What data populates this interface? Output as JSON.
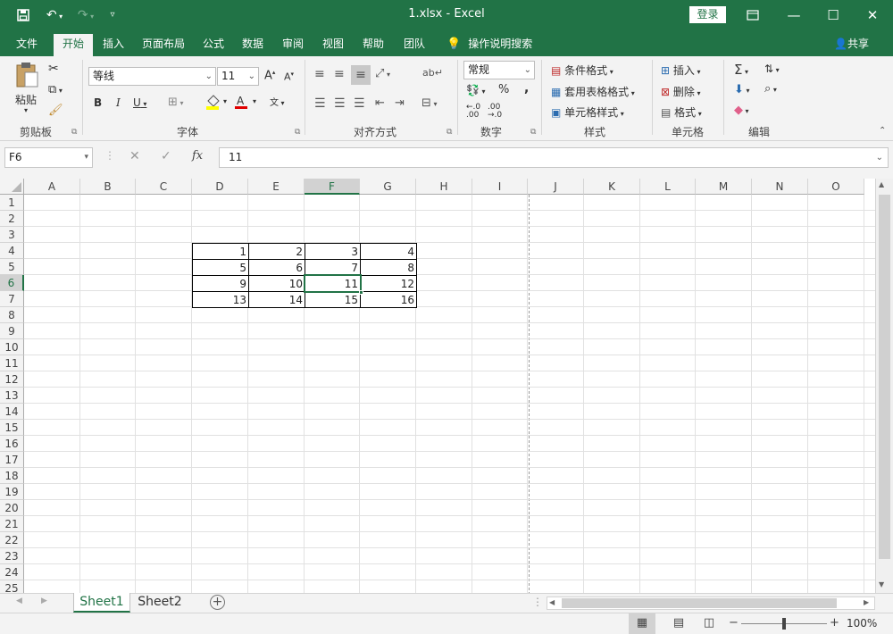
{
  "window": {
    "title": "1.xlsx  -  Excel",
    "login_label": "登录",
    "qat": {
      "save_icon": "save-icon",
      "undo_icon": "undo-icon",
      "redo_icon": "redo-icon",
      "customize_icon": "chevron-down-icon"
    },
    "controls": {
      "ribbon_display": "ribbon-display-icon",
      "minimize": "minimize-icon",
      "maximize": "maximize-icon",
      "close": "close-icon"
    }
  },
  "tabs": [
    "文件",
    "开始",
    "插入",
    "页面布局",
    "公式",
    "数据",
    "审阅",
    "视图",
    "帮助",
    "团队"
  ],
  "active_tab": "开始",
  "tell_me": "操作说明搜索",
  "share": "共享",
  "ribbon": {
    "clipboard": {
      "label": "剪贴板",
      "paste": "粘贴"
    },
    "font": {
      "label": "字体",
      "font_name": "等线",
      "font_size": "11",
      "bold": "B",
      "italic": "I",
      "underline": "U"
    },
    "alignment": {
      "label": "对齐方式"
    },
    "number": {
      "label": "数字",
      "format": "常规",
      "percent": "%",
      "comma": ","
    },
    "styles": {
      "label": "样式",
      "conditional": "条件格式",
      "table_format": "套用表格格式",
      "cell_styles": "单元格样式"
    },
    "cells": {
      "label": "单元格",
      "insert": "插入",
      "delete": "删除",
      "format": "格式"
    },
    "editing": {
      "label": "编辑"
    }
  },
  "formula_bar": {
    "name_box": "F6",
    "fx": "fx",
    "content": "11"
  },
  "grid": {
    "columns": [
      "A",
      "B",
      "C",
      "D",
      "E",
      "F",
      "G",
      "H",
      "I",
      "J",
      "K",
      "L",
      "M",
      "N",
      "O"
    ],
    "rows": [
      "1",
      "2",
      "3",
      "4",
      "5",
      "6",
      "7",
      "8",
      "9",
      "10",
      "11",
      "12",
      "13",
      "14",
      "15",
      "16",
      "17",
      "18",
      "19",
      "20",
      "21",
      "22",
      "23",
      "24",
      "25"
    ],
    "selected_col": "F",
    "selected_row": "6",
    "data": [
      {
        "row": 4,
        "values": [
          "1",
          "2",
          "3",
          "4"
        ]
      },
      {
        "row": 5,
        "values": [
          "5",
          "6",
          "7",
          "8"
        ]
      },
      {
        "row": 6,
        "values": [
          "9",
          "10",
          "11",
          "12"
        ]
      },
      {
        "row": 7,
        "values": [
          "13",
          "14",
          "15",
          "16"
        ]
      }
    ]
  },
  "sheets": [
    "Sheet1",
    "Sheet2"
  ],
  "active_sheet": "Sheet1",
  "status": {
    "zoom": "100%"
  }
}
